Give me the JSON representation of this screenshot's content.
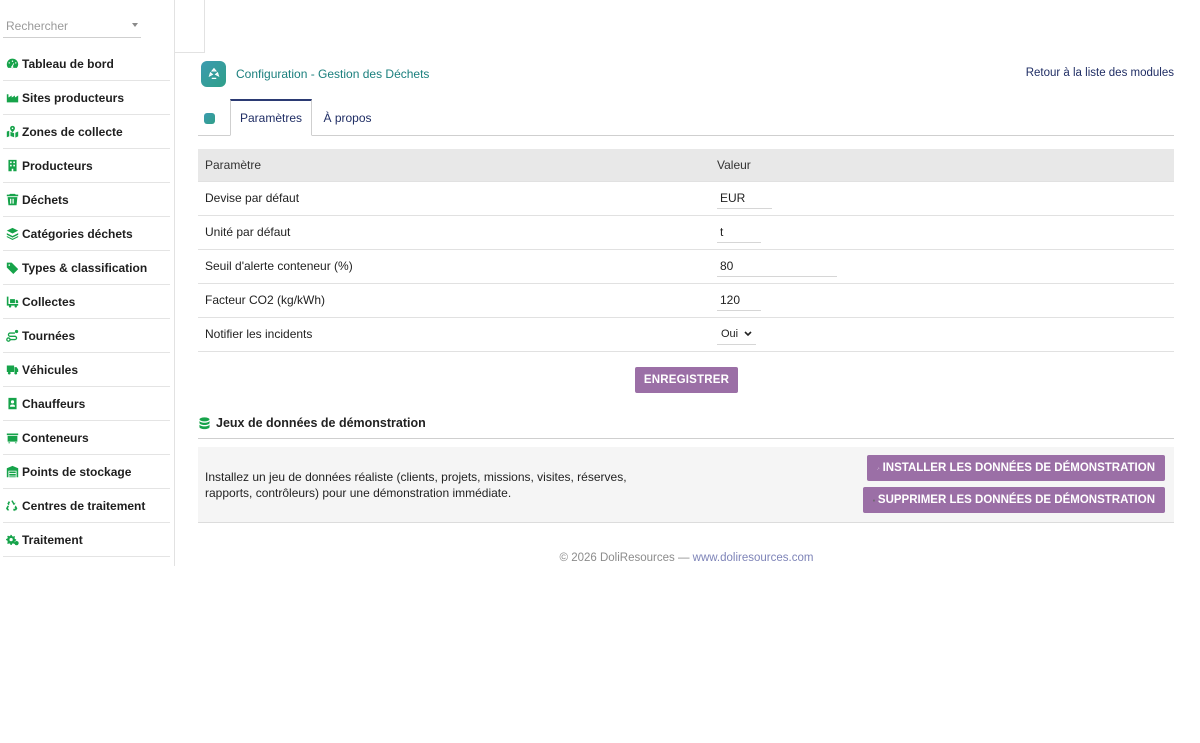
{
  "sidebar": {
    "search_placeholder": "Rechercher",
    "items": [
      {
        "label": "Tableau de bord",
        "icon": "dashboard-icon"
      },
      {
        "label": "Sites producteurs",
        "icon": "industry-icon"
      },
      {
        "label": "Zones de collecte",
        "icon": "map-icon"
      },
      {
        "label": "Producteurs",
        "icon": "building-icon"
      },
      {
        "label": "Déchets",
        "icon": "trash-icon"
      },
      {
        "label": "Catégories déchets",
        "icon": "layers-icon"
      },
      {
        "label": "Types & classification",
        "icon": "tags-icon"
      },
      {
        "label": "Collectes",
        "icon": "truck-loading-icon"
      },
      {
        "label": "Tournées",
        "icon": "route-icon"
      },
      {
        "label": "Véhicules",
        "icon": "truck-icon"
      },
      {
        "label": "Chauffeurs",
        "icon": "id-badge-icon"
      },
      {
        "label": "Conteneurs",
        "icon": "dumpster-icon"
      },
      {
        "label": "Points de stockage",
        "icon": "warehouse-icon"
      },
      {
        "label": "Centres de traitement",
        "icon": "recycle-icon"
      },
      {
        "label": "Traitement",
        "icon": "cogs-icon"
      }
    ]
  },
  "header": {
    "title": "Configuration - Gestion des Déchets",
    "back_link": "Retour à la liste des modules"
  },
  "tabs": [
    {
      "label": "Paramètres",
      "active": true
    },
    {
      "label": "À propos",
      "active": false
    }
  ],
  "params": {
    "col_name": "Paramètre",
    "col_value": "Valeur",
    "rows": [
      {
        "name": "Devise par défaut",
        "value": "EUR"
      },
      {
        "name": "Unité par défaut",
        "value": "t"
      },
      {
        "name": "Seuil d'alerte conteneur (%)",
        "value": "80"
      },
      {
        "name": "Facteur CO2 (kg/kWh)",
        "value": "120"
      },
      {
        "name": "Notifier les incidents",
        "value": "Oui"
      }
    ],
    "save_label": "ENREGISTRER"
  },
  "demo": {
    "title": "Jeux de données de démonstration",
    "description": "Installez un jeu de données réaliste (clients, projets, missions, visites, réserves, rapports, contrôleurs) pour une démonstration immédiate.",
    "install_label": "INSTALLER LES DONNÉES DE DÉMONSTRATION",
    "delete_label": "SUPPRIMER LES DONNÉES DE DÉMONSTRATION"
  },
  "footer": {
    "text": "© 2026 DoliResources —",
    "link": "www.doliresources.com"
  },
  "colors": {
    "icon_green": "#16a34a",
    "button_purple": "#9b6fa6",
    "title_teal": "#1a7f7d",
    "link_navy": "#1f2d64"
  }
}
